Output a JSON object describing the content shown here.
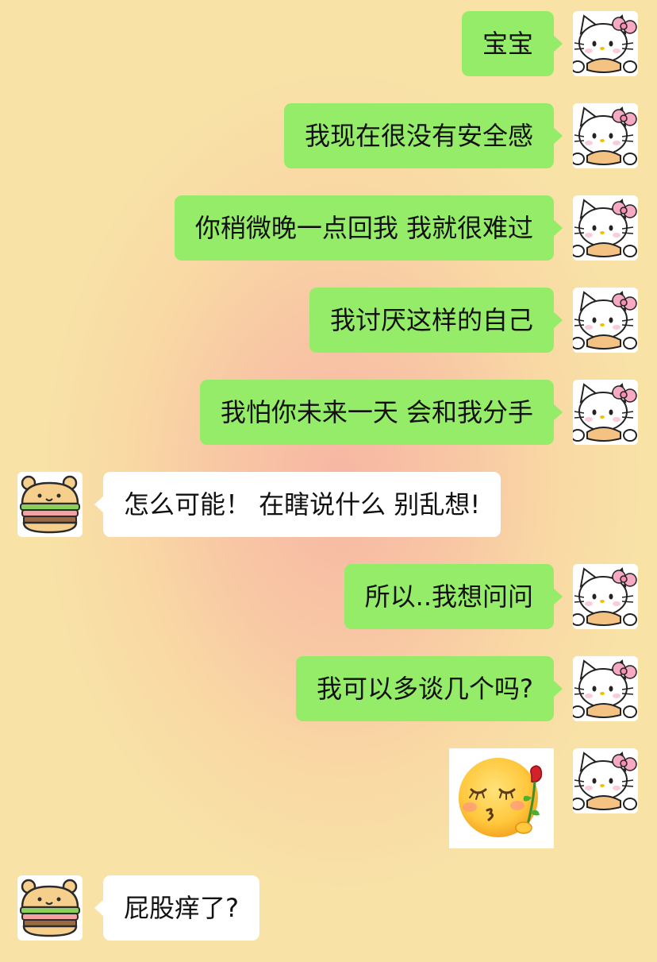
{
  "messages": [
    {
      "side": "me",
      "text": "宝宝"
    },
    {
      "side": "me",
      "text": "我现在很没有安全感"
    },
    {
      "side": "me",
      "text": "你稍微晚一点回我 我就很难过"
    },
    {
      "side": "me",
      "text": "我讨厌这样的自己"
    },
    {
      "side": "me",
      "text": "我怕你未来一天 会和我分手"
    },
    {
      "side": "other",
      "text": "怎么可能！ 在瞎说什么 别乱想!"
    },
    {
      "side": "me",
      "text": "所以..我想问问"
    },
    {
      "side": "me",
      "text": "我可以多谈几个吗?"
    },
    {
      "side": "me",
      "sticker": "kissing-face-with-rose-emoji"
    },
    {
      "side": "other",
      "text": "屁股痒了?"
    }
  ],
  "avatars": {
    "me": "hello-kitty-avatar-icon",
    "other": "cartoon-bear-burger-avatar-icon"
  },
  "colors": {
    "my_bubble": "#95ec69",
    "other_bubble": "#ffffff",
    "background": "#f8e0a6"
  }
}
